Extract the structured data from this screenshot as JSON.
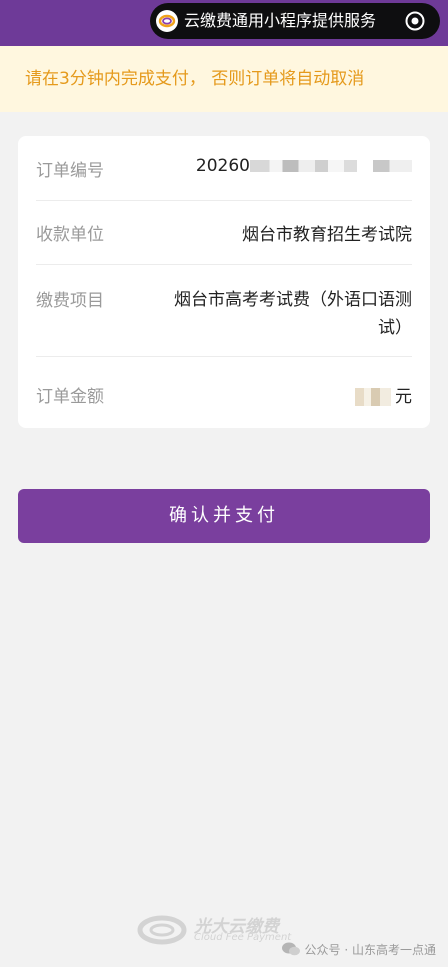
{
  "capsule": {
    "text": "云缴费通用小程序提供服务",
    "logo_icon": "cloudpay-logo-icon",
    "menu_icon": "target-icon"
  },
  "notice": {
    "text": "请在3分钟内完成支付， 否则订单将自动取消"
  },
  "order": {
    "rows": [
      {
        "label": "订单编号",
        "value": "20260"
      },
      {
        "label": "收款单位",
        "value": "烟台市教育招生考试院"
      },
      {
        "label": "缴费项目",
        "value_line1": "烟台市高考考试费（外语口语测",
        "value_line2": "试）"
      },
      {
        "label": "订单金额",
        "unit": "元"
      }
    ]
  },
  "pay_button": {
    "label": "确认并支付"
  },
  "footer": {
    "brand_cn": "光大云缴费",
    "brand_en": "Cloud Fee Payment"
  },
  "watermark": {
    "text": "公众号 · 山东高考一点通"
  },
  "colors": {
    "brand_purple": "#6e3a98",
    "button_purple": "#7a3f9e",
    "notice_bg": "#fff7df",
    "notice_text": "#e59a1c"
  }
}
